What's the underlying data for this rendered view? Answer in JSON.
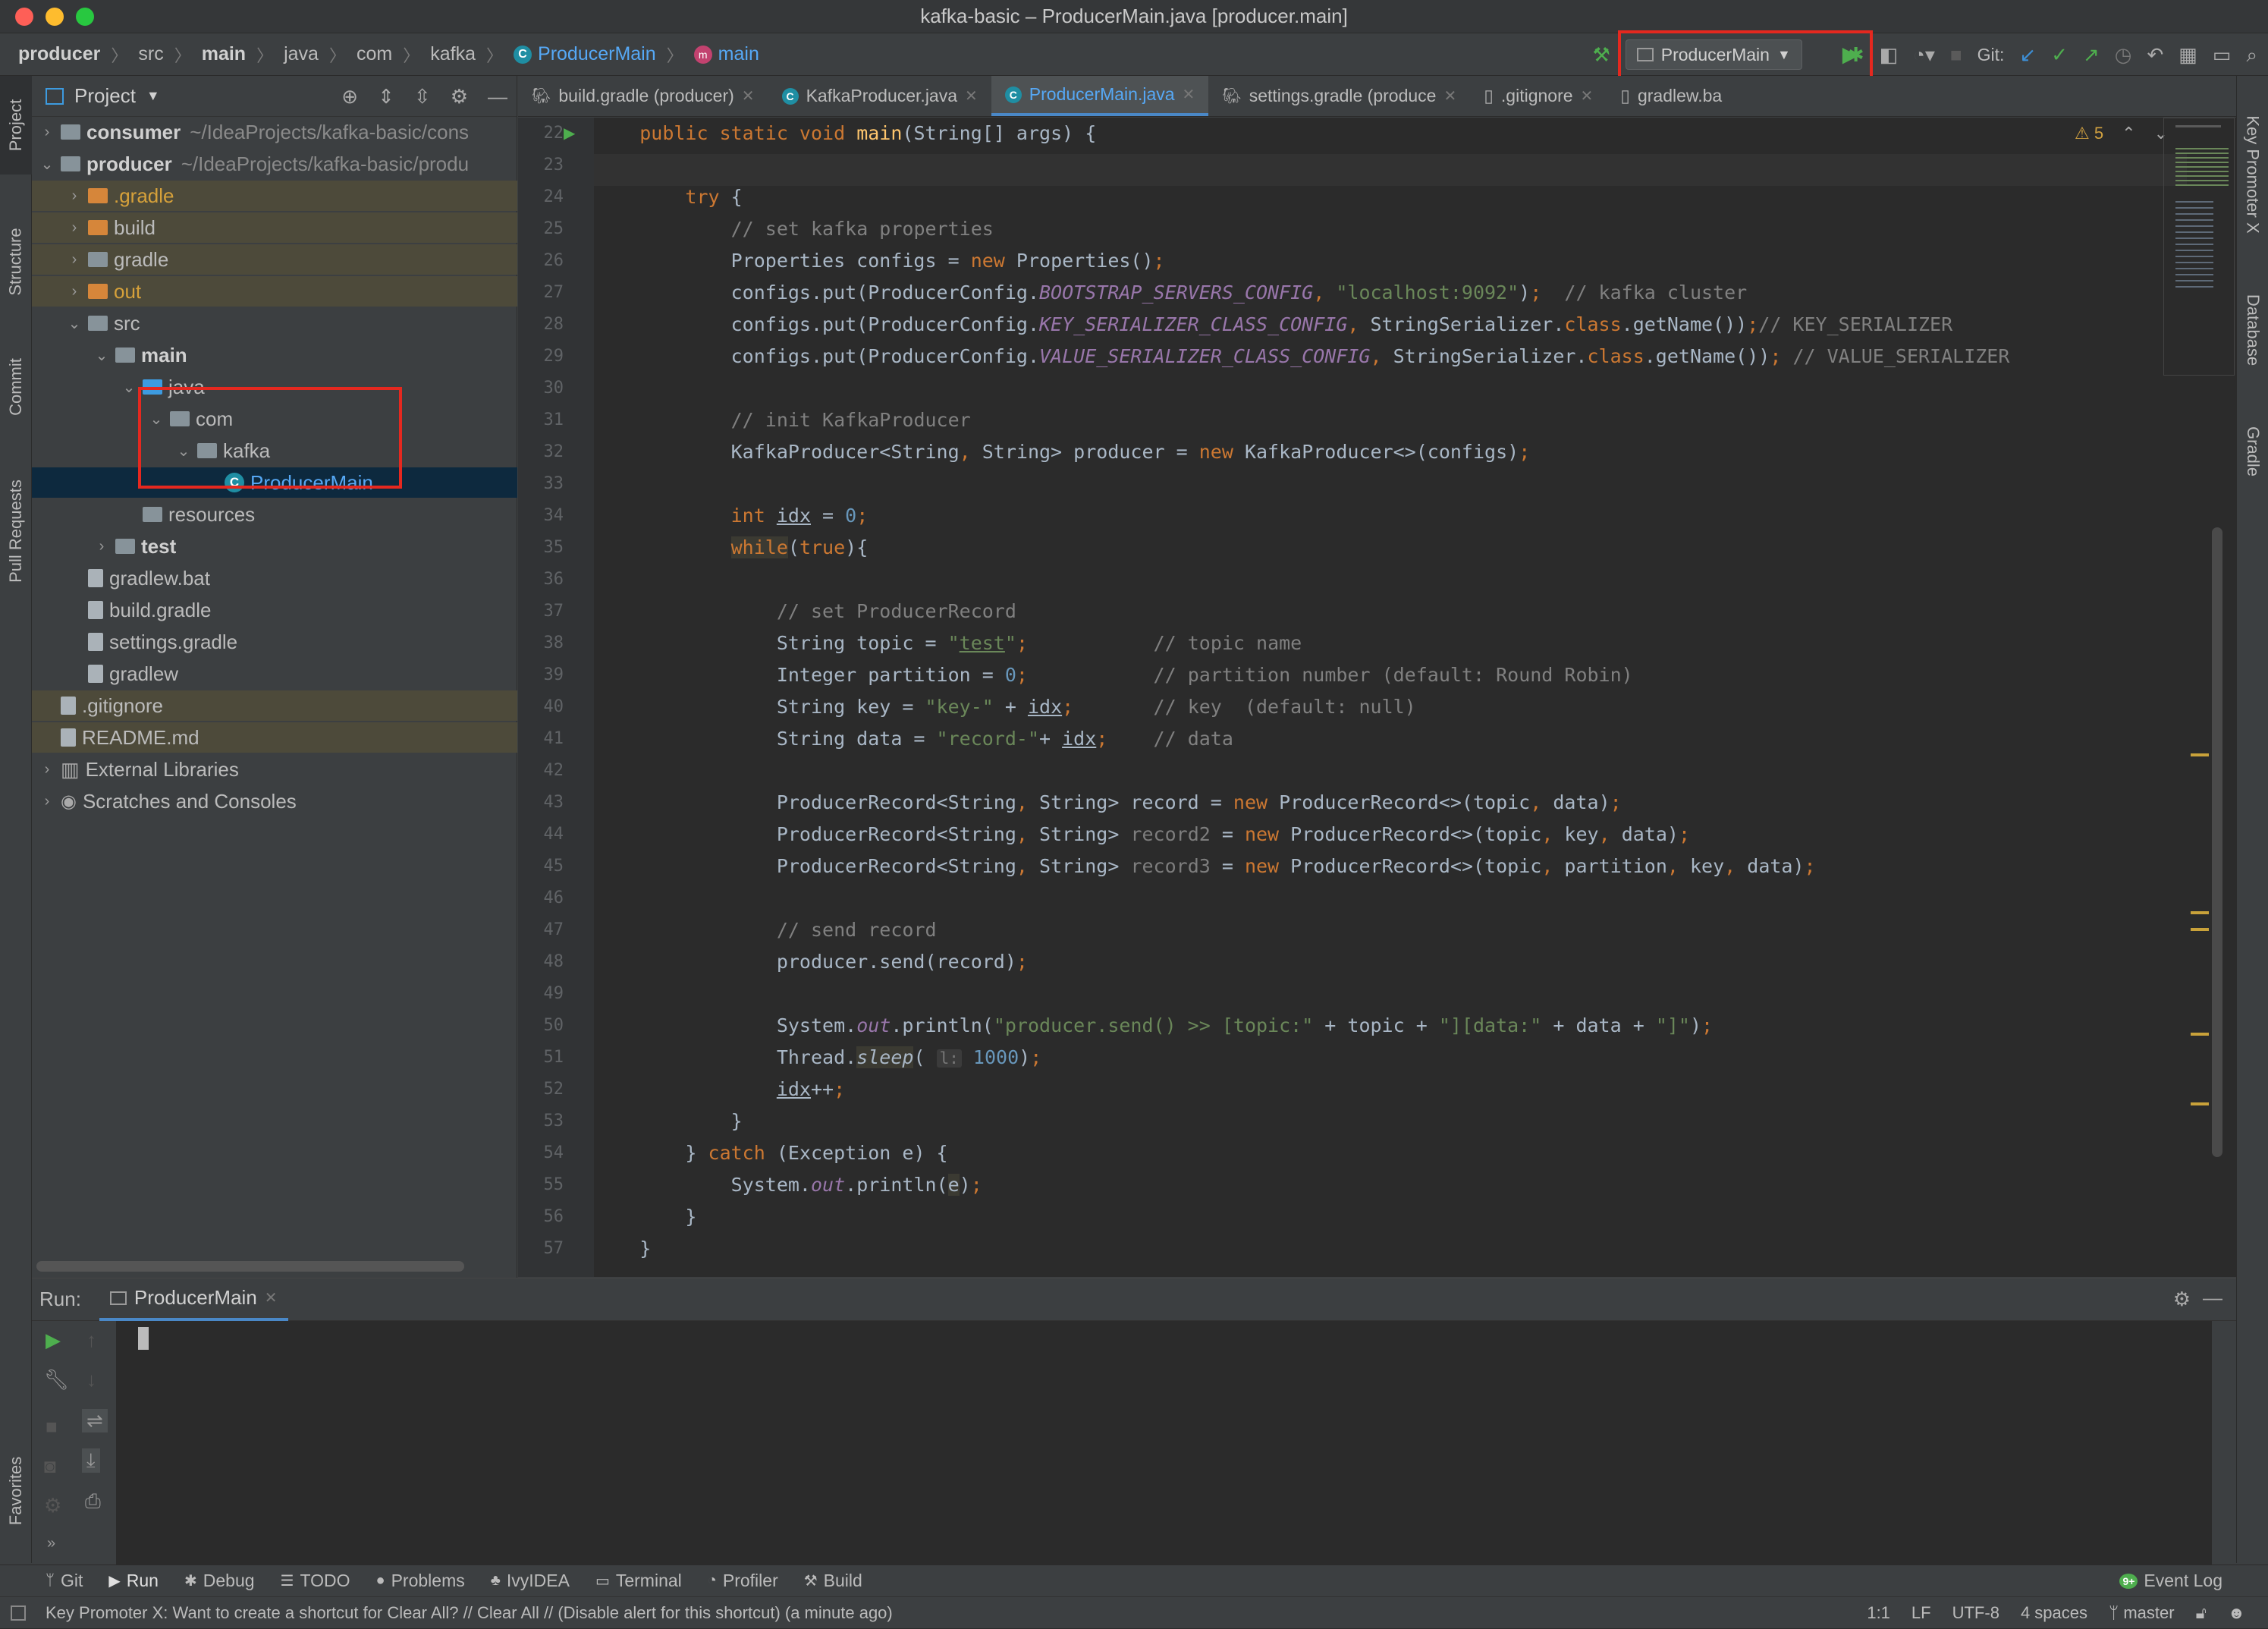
{
  "window": {
    "title": "kafka-basic – ProducerMain.java [producer.main]"
  },
  "breadcrumbs": [
    {
      "label": "producer",
      "bold": true
    },
    {
      "label": "src"
    },
    {
      "label": "main",
      "bold": true
    },
    {
      "label": "java"
    },
    {
      "label": "com"
    },
    {
      "label": "kafka"
    },
    {
      "label": "ProducerMain",
      "icon": "class-icon"
    },
    {
      "label": "main",
      "icon": "method-icon"
    }
  ],
  "toolbar": {
    "run_config": "ProducerMain",
    "git_label": "Git:"
  },
  "left_tabs": {
    "project": "Project",
    "structure": "Structure",
    "commit": "Commit",
    "pull_requests": "Pull Requests",
    "favorites": "Favorites"
  },
  "right_tabs": {
    "key_promoter": "Key Promoter X",
    "database": "Database",
    "gradle": "Gradle"
  },
  "project_panel": {
    "title": "Project",
    "tree": [
      {
        "label": "consumer",
        "hint": "~/IdeaProjects/kafka-basic/cons",
        "level": 0,
        "arrow": "›",
        "kind": "module"
      },
      {
        "label": "producer",
        "hint": "~/IdeaProjects/kafka-basic/produ",
        "level": 0,
        "arrow": "⌄",
        "kind": "module"
      },
      {
        "label": ".gradle",
        "level": 1,
        "arrow": "›",
        "kind": "folder-orange"
      },
      {
        "label": "build",
        "level": 1,
        "arrow": "›",
        "kind": "folder-orange"
      },
      {
        "label": "gradle",
        "level": 1,
        "arrow": "›",
        "kind": "folder"
      },
      {
        "label": "out",
        "level": 1,
        "arrow": "›",
        "kind": "folder-orange"
      },
      {
        "label": "src",
        "level": 1,
        "arrow": "⌄",
        "kind": "folder"
      },
      {
        "label": "main",
        "level": 2,
        "arrow": "⌄",
        "kind": "folder"
      },
      {
        "label": "java",
        "level": 3,
        "arrow": "⌄",
        "kind": "folder-blue"
      },
      {
        "label": "com",
        "level": 4,
        "arrow": "⌄",
        "kind": "folder"
      },
      {
        "label": "kafka",
        "level": 5,
        "arrow": "⌄",
        "kind": "folder"
      },
      {
        "label": "ProducerMain",
        "level": 6,
        "arrow": "",
        "kind": "class"
      },
      {
        "label": "resources",
        "level": 3,
        "arrow": "",
        "kind": "folder"
      },
      {
        "label": "test",
        "level": 2,
        "arrow": "›",
        "kind": "folder"
      },
      {
        "label": "gradlew.bat",
        "level": 1,
        "arrow": "",
        "kind": "file"
      },
      {
        "label": "build.gradle",
        "level": 1,
        "arrow": "",
        "kind": "file"
      },
      {
        "label": "settings.gradle",
        "level": 1,
        "arrow": "",
        "kind": "file"
      },
      {
        "label": "gradlew",
        "level": 1,
        "arrow": "",
        "kind": "file"
      },
      {
        "label": ".gitignore",
        "level": 0,
        "arrow": "",
        "kind": "file"
      },
      {
        "label": "README.md",
        "level": 0,
        "arrow": "",
        "kind": "file"
      },
      {
        "label": "External Libraries",
        "level": 0,
        "arrow": "›",
        "kind": "lib"
      },
      {
        "label": "Scratches and Consoles",
        "level": 0,
        "arrow": "›",
        "kind": "scratch"
      }
    ]
  },
  "editor_tabs": [
    {
      "label": "build.gradle (producer)"
    },
    {
      "label": "KafkaProducer.java"
    },
    {
      "label": "ProducerMain.java",
      "active": true
    },
    {
      "label": "settings.gradle (produce"
    },
    {
      "label": ".gitignore"
    },
    {
      "label": "gradlew.ba"
    }
  ],
  "editor": {
    "warning_count": "5",
    "lines": [
      {
        "n": "22",
        "html": "    <span class=\"k\">public static void </span><span class=\"fn\">main</span>(String[] args) {"
      },
      {
        "n": "23",
        "html": ""
      },
      {
        "n": "24",
        "html": "        <span class=\"k\">try </span>{"
      },
      {
        "n": "25",
        "html": "            <span class=\"c\">// set kafka properties</span>"
      },
      {
        "n": "26",
        "html": "            Properties configs = <span class=\"k\">new </span>Properties()<span class=\"k\">;</span>"
      },
      {
        "n": "27",
        "html": "            configs.put(ProducerConfig.<span class=\"f\">BOOTSTRAP_SERVERS_CONFIG</span><span class=\"k\">, </span><span class=\"s\">\"localhost:9092\"</span>)<span class=\"k\">;  </span><span class=\"c\">// kafka cluster</span>"
      },
      {
        "n": "28",
        "html": "            configs.put(ProducerConfig.<span class=\"f\">KEY_SERIALIZER_CLASS_CONFIG</span><span class=\"k\">, </span>StringSerializer.<span class=\"k\">class</span>.getName())<span class=\"k\">;</span><span class=\"c\">// KEY_SERIALIZER</span>"
      },
      {
        "n": "29",
        "html": "            configs.put(ProducerConfig.<span class=\"f\">VALUE_SERIALIZER_CLASS_CONFIG</span><span class=\"k\">, </span>StringSerializer.<span class=\"k\">class</span>.getName())<span class=\"k\">; </span><span class=\"c\">// VALUE_SERIALIZER</span>"
      },
      {
        "n": "30",
        "html": ""
      },
      {
        "n": "31",
        "html": "            <span class=\"c\">// init KafkaProducer</span>"
      },
      {
        "n": "32",
        "html": "            KafkaProducer&lt;String<span class=\"k\">, </span>String&gt; producer = <span class=\"k\">new </span>KafkaProducer&lt;&gt;(configs)<span class=\"k\">;</span>"
      },
      {
        "n": "33",
        "html": ""
      },
      {
        "n": "34",
        "html": "            <span class=\"k\">int </span><span class=\"u\">idx</span> = <span class=\"n\">0</span><span class=\"k\">;</span>"
      },
      {
        "n": "35",
        "html": "            <span class=\"k while-bg\">while</span>(<span class=\"k\">true</span>){"
      },
      {
        "n": "36",
        "html": ""
      },
      {
        "n": "37",
        "html": "                <span class=\"c\">// set ProducerRecord</span>"
      },
      {
        "n": "38",
        "html": "                String topic = <span class=\"s\">\"<span class=\"u\">test</span>\"</span><span class=\"k\">;           </span><span class=\"c\">// topic name</span>"
      },
      {
        "n": "39",
        "html": "                Integer partition = <span class=\"n\">0</span><span class=\"k\">;           </span><span class=\"c\">// partition number (default: Round Robin)</span>"
      },
      {
        "n": "40",
        "html": "                String key = <span class=\"s\">\"key-\"</span> + <span class=\"u\">idx</span><span class=\"k\">;       </span><span class=\"c\">// key  (default: null)</span>"
      },
      {
        "n": "41",
        "html": "                String data = <span class=\"s\">\"record-\"</span>+ <span class=\"u\">idx</span><span class=\"k\">;    </span><span class=\"c\">// data</span>"
      },
      {
        "n": "42",
        "html": ""
      },
      {
        "n": "43",
        "html": "                ProducerRecord&lt;String<span class=\"k\">, </span>String&gt; record = <span class=\"k\">new </span>ProducerRecord&lt;&gt;(topic<span class=\"k\">, </span>data)<span class=\"k\">;</span>"
      },
      {
        "n": "44",
        "html": "                ProducerRecord&lt;String<span class=\"k\">, </span>String&gt; <span class=\"fadeg\">record2</span> = <span class=\"k\">new </span>ProducerRecord&lt;&gt;(topic<span class=\"k\">, </span>key<span class=\"k\">, </span>data)<span class=\"k\">;</span>"
      },
      {
        "n": "45",
        "html": "                ProducerRecord&lt;String<span class=\"k\">, </span>String&gt; <span class=\"fadeg\">record3</span> = <span class=\"k\">new </span>ProducerRecord&lt;&gt;(topic<span class=\"k\">, </span>partition<span class=\"k\">, </span>key<span class=\"k\">, </span>data)<span class=\"k\">;</span>"
      },
      {
        "n": "46",
        "html": ""
      },
      {
        "n": "47",
        "html": "                <span class=\"c\">// send record</span>"
      },
      {
        "n": "48",
        "html": "                producer.send(record)<span class=\"k\">;</span>"
      },
      {
        "n": "49",
        "html": ""
      },
      {
        "n": "50",
        "html": "                System.<span class=\"f\">out</span>.println(<span class=\"s\">\"producer.send() &gt;&gt; [topic:\"</span> + topic + <span class=\"s\">\"][data:\"</span> + data + <span class=\"s\">\"]\"</span>)<span class=\"k\">;</span>"
      },
      {
        "n": "51",
        "html": "                Thread.<span class=\"it while-bg\">sleep</span>( <span class=\"hint\">l:</span> <span class=\"n\">1000</span>)<span class=\"k\">;</span>"
      },
      {
        "n": "52",
        "html": "                <span class=\"u\">idx</span>++<span class=\"k\">;</span>"
      },
      {
        "n": "53",
        "html": "            }"
      },
      {
        "n": "54",
        "html": "        } <span class=\"k\">catch </span>(Exception e) {"
      },
      {
        "n": "55",
        "html": "            System.<span class=\"f\">out</span>.println(<span class=\"while-bg\">e</span>)<span class=\"k\">;</span>"
      },
      {
        "n": "56",
        "html": "        }"
      },
      {
        "n": "57",
        "html": "    }"
      }
    ]
  },
  "run_panel": {
    "label": "Run:",
    "tab": "ProducerMain"
  },
  "tool_windows": [
    {
      "label": "Git",
      "icon": "git-branch-icon"
    },
    {
      "label": "Run",
      "icon": "play-icon",
      "active": true
    },
    {
      "label": "Debug",
      "icon": "bug-icon"
    },
    {
      "label": "TODO",
      "icon": "list-icon"
    },
    {
      "label": "Problems",
      "icon": "info-icon"
    },
    {
      "label": "IvyIDEA",
      "icon": "ivy-icon"
    },
    {
      "label": "Terminal",
      "icon": "terminal-icon"
    },
    {
      "label": "Profiler",
      "icon": "profiler-icon"
    },
    {
      "label": "Build",
      "icon": "hammer-icon"
    }
  ],
  "event_log": {
    "label": "Event Log",
    "badge": "9+"
  },
  "status": {
    "message": "Key Promoter X: Want to create a shortcut for Clear All? // Clear All // (Disable alert for this shortcut) (a minute ago)",
    "position": "1:1",
    "line_sep": "LF",
    "encoding": "UTF-8",
    "indent": "4 spaces",
    "branch": "master"
  },
  "colors": {
    "accent": "#4a88c7",
    "highlight_box": "#e5281f",
    "run_green": "#4eae4e"
  }
}
